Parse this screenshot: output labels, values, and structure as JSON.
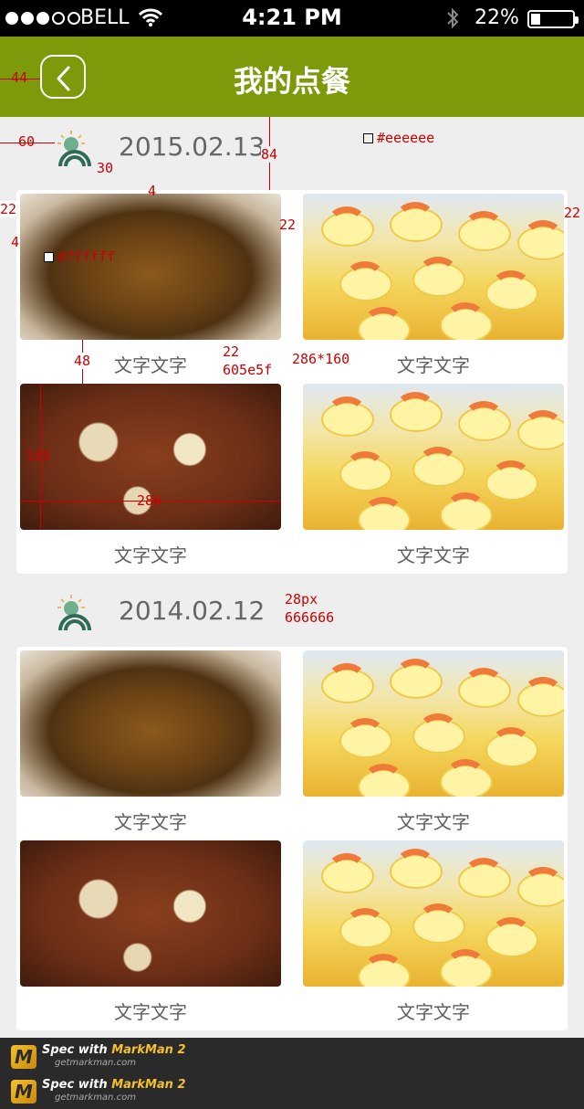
{
  "status_bar": {
    "carrier": "BELL",
    "time": "4:21 PM",
    "battery_percent_text": "22%",
    "battery_level": 0.22
  },
  "nav": {
    "title": "我的点餐",
    "back_icon": "chevron-left-icon"
  },
  "sections": [
    {
      "date": "2015.02.13",
      "items": [
        {
          "label": "文字文字",
          "image": "fried-noodles"
        },
        {
          "label": "文字文字",
          "image": "shrimp-tofu"
        },
        {
          "label": "文字文字",
          "image": "braised-stew"
        },
        {
          "label": "文字文字",
          "image": "shrimp-tofu"
        }
      ]
    },
    {
      "date": "2014.02.12",
      "items": [
        {
          "label": "文字文字",
          "image": "fried-noodles"
        },
        {
          "label": "文字文字",
          "image": "shrimp-tofu"
        },
        {
          "label": "文字文字",
          "image": "braised-stew"
        },
        {
          "label": "文字文字",
          "image": "shrimp-tofu"
        }
      ]
    }
  ],
  "annotations": {
    "nav_left": "44",
    "icon_left": "60",
    "icon_gap": "30",
    "section_top": "84",
    "bg_color": "#eeeeee",
    "card_margin_left": "22",
    "card_margin_right": "22",
    "image_gap_top": "4",
    "card_inset": "4",
    "card_color": "#ffffff",
    "label_gap": "48",
    "label_size": "22",
    "label_color": "605e5f",
    "image_size": "286*160",
    "img_height": "160",
    "img_width": "286",
    "date_size": "28px",
    "date_color": "666666"
  },
  "footer": {
    "brand_prefix": "Spec with ",
    "brand_name": "MarkMan 2",
    "url": "getmarkman.com"
  },
  "colors": {
    "nav_green": "#7c9a0a",
    "background": "#eeeeee",
    "card": "#ffffff",
    "label": "#605e5f",
    "date": "#666666",
    "annotation": "#cc0000"
  }
}
